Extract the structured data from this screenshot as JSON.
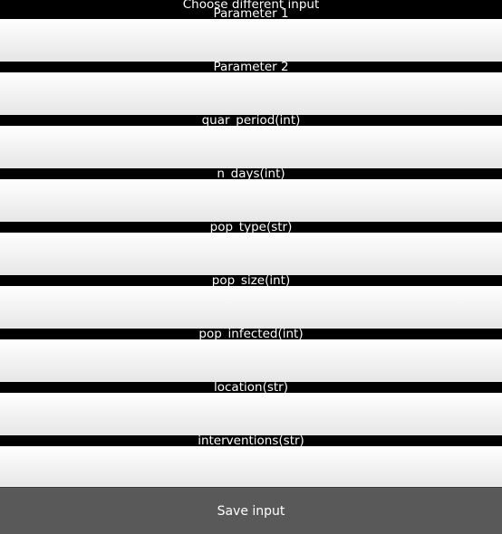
{
  "header": {
    "title": "Choose different input"
  },
  "fields": [
    {
      "label": "Parameter 1",
      "value": ""
    },
    {
      "label": "Parameter 2",
      "value": ""
    },
    {
      "label": "quar_period(int)",
      "value": ""
    },
    {
      "label": "n_days(int)",
      "value": ""
    },
    {
      "label": "pop_type(str)",
      "value": ""
    },
    {
      "label": "pop_size(int)",
      "value": ""
    },
    {
      "label": "pop_infected(int)",
      "value": ""
    },
    {
      "label": "location(str)",
      "value": ""
    },
    {
      "label": "interventions(str)",
      "value": ""
    }
  ],
  "save_button": {
    "label": "Save input"
  },
  "colors": {
    "background": "#000000",
    "text": "#ffffff",
    "input_top": "#ffffff",
    "input_bottom": "#e6e6e6",
    "button": "#595959"
  }
}
